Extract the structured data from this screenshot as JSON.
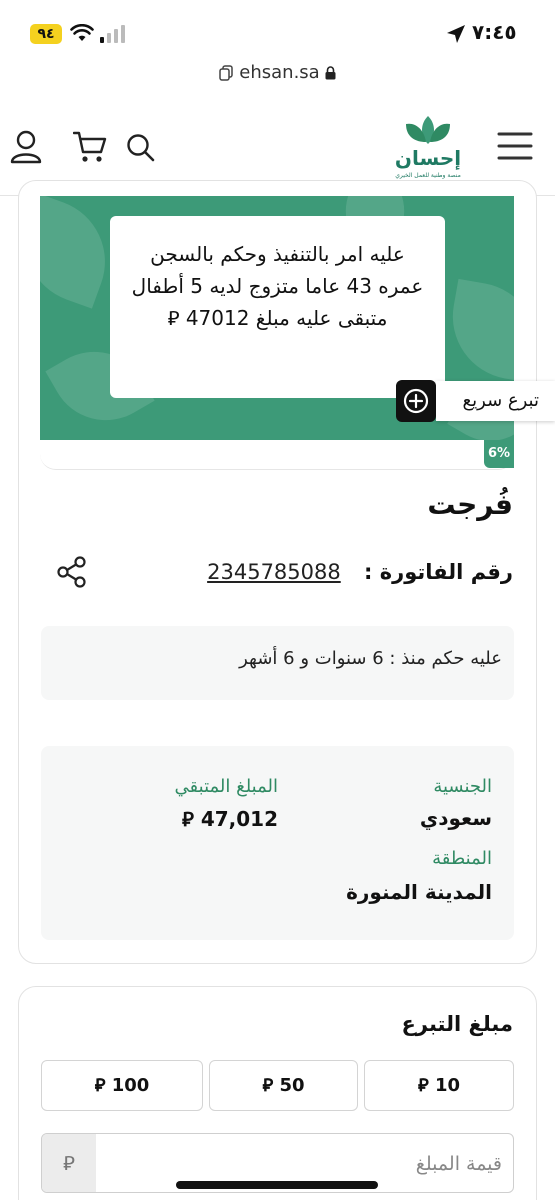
{
  "status_bar": {
    "time": "٧:٤٥",
    "battery": "٩٤"
  },
  "browser": {
    "url": "ehsan.sa"
  },
  "header": {
    "logo_name": "إحسان",
    "logo_tagline": "منصة وطنية للعمل الخيري"
  },
  "case": {
    "description": "عليه امر بالتنفيذ وحكم بالسجن عمره 43 عاما متزوج لديه 5 أطفال متبقى عليه مبلغ 47012 ⃁",
    "quick_donate_label": "تبرع سريع",
    "progress": "6%",
    "title": "فُرجت",
    "invoice_label": "رقم الفاتورة :",
    "invoice_number": "2345785088",
    "sentence": "عليه حكم منذ : 6 سنوات و 6 أشهر",
    "nationality_label": "الجنسية",
    "nationality_value": "سعودي",
    "region_label": "المنطقة",
    "region_value": "المدينة المنورة",
    "remaining_label": "المبلغ المتبقي",
    "remaining_value": "47,012",
    "currency_symbol": "⃁"
  },
  "donation": {
    "title": "مبلغ التبرع",
    "options": [
      "10",
      "50",
      "100"
    ],
    "amount_placeholder": "قيمة المبلغ"
  }
}
